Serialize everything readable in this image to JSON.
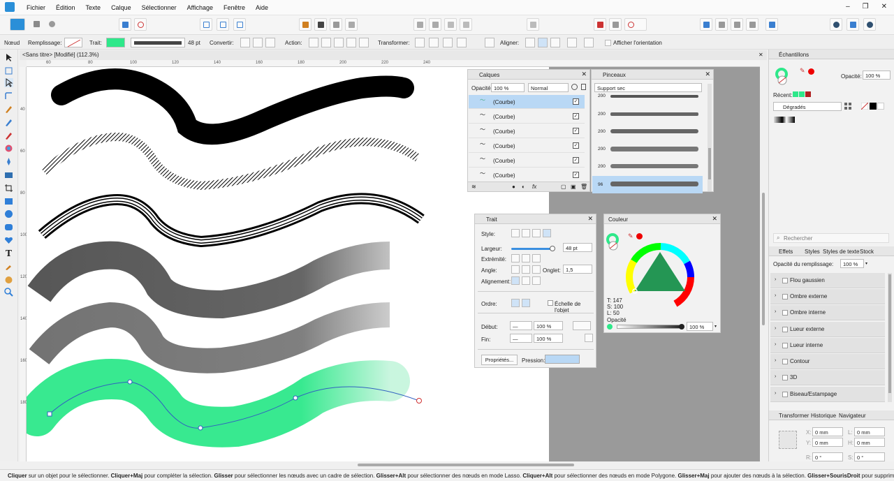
{
  "menubar": {
    "items": [
      "Fichier",
      "Édition",
      "Texte",
      "Calque",
      "Sélectionner",
      "Affichage",
      "Fenêtre",
      "Aide"
    ]
  },
  "window": {
    "minimize": "–",
    "maximize": "❐",
    "close": "✕"
  },
  "context": {
    "node_label": "Nœud",
    "fill_label": "Remplissage:",
    "stroke_label": "Trait:",
    "stroke_color": "#2ee88a",
    "width_value": "48 pt",
    "convert_label": "Convertir:",
    "action_label": "Action:",
    "transform_label": "Transformer:",
    "align_label": "Aligner:",
    "show_orientation": "Afficher l'orientation"
  },
  "document": {
    "title": "<Sans titre> [Modifié] (112.3%)",
    "close": "✕"
  },
  "ruler": {
    "h": [
      "60",
      "80",
      "100",
      "120",
      "140",
      "160",
      "180",
      "200",
      "220",
      "240"
    ],
    "v": [
      "40",
      "60",
      "80",
      "100",
      "120",
      "140",
      "160",
      "180"
    ]
  },
  "layers": {
    "title": "Calques",
    "opacity_label": "Opacité:",
    "opacity": "100 %",
    "blend": "Normal",
    "rows": [
      "(Courbe)",
      "(Courbe)",
      "(Courbe)",
      "(Courbe)",
      "(Courbe)",
      "(Courbe)"
    ],
    "check": "✓",
    "fx": "fx"
  },
  "brushes": {
    "title": "Pinceaux",
    "category": "Support sec",
    "sizes": [
      "200",
      "200",
      "200",
      "200",
      "200",
      "96"
    ]
  },
  "stroke": {
    "title": "Trait",
    "style_label": "Style:",
    "width_label": "Largeur:",
    "width": "48 pt",
    "cap_label": "Extrémité:",
    "join_label": "Angle:",
    "miter_label": "Onglet:",
    "miter": "1,5",
    "align_label": "Alignement:",
    "order_label": "Ordre:",
    "scale_label": "Échelle de l'objet",
    "start_label": "Début:",
    "start_pct": "100 %",
    "end_label": "Fin:",
    "end_pct": "100 %",
    "props_btn": "Propriétés...",
    "pressure_label": "Pression:"
  },
  "color": {
    "title": "Couleur",
    "t": "T: 147",
    "s": "S: 100",
    "l": "L: 50",
    "opacity_label": "Opacité",
    "opacity": "100 %",
    "accent": "#2ee88a"
  },
  "swatches": {
    "title": "Échantillons",
    "opacity_label": "Opacité:",
    "opacity": "100 %",
    "recent_label": "Récent:",
    "palette": "Dégradés"
  },
  "search": {
    "placeholder": "Rechercher"
  },
  "effects": {
    "tabs": [
      "Effets",
      "Styles",
      "Styles de texte",
      "Stock"
    ],
    "fill_opacity_label": "Opacité du remplissage:",
    "fill_opacity": "100 %",
    "items": [
      "Flou gaussien",
      "Ombre externe",
      "Ombre interne",
      "Lueur externe",
      "Lueur interne",
      "Contour",
      "3D",
      "Biseau/Estampage"
    ]
  },
  "transform": {
    "tabs": [
      "Transformer",
      "Historique",
      "Navigateur"
    ],
    "x_label": "X:",
    "y_label": "Y:",
    "w_label": "L:",
    "h_label": "H:",
    "r_label": "R:",
    "s_label": "S:",
    "x": "0 mm",
    "y": "0 mm",
    "w": "0 mm",
    "h": "0 mm",
    "r": "0 °",
    "s": "0 °"
  },
  "status": {
    "parts": [
      [
        "Cliquer",
        " sur un objet pour le sélectionner. "
      ],
      [
        "Cliquer+Maj",
        " pour compléter la sélection. "
      ],
      [
        "Glisser",
        " pour sélectionner les nœuds avec un cadre de sélection. "
      ],
      [
        "Glisser+Alt",
        " pour sélectionner des nœuds en mode Lasso. "
      ],
      [
        "Cliquer+Alt",
        " pour sélectionner des nœuds en mode Polygone. "
      ],
      [
        "Glisser+Maj",
        " pour ajouter des nœuds à la sélection. "
      ],
      [
        "Glisser+SourisDroit",
        " pour supprimer c"
      ]
    ]
  }
}
